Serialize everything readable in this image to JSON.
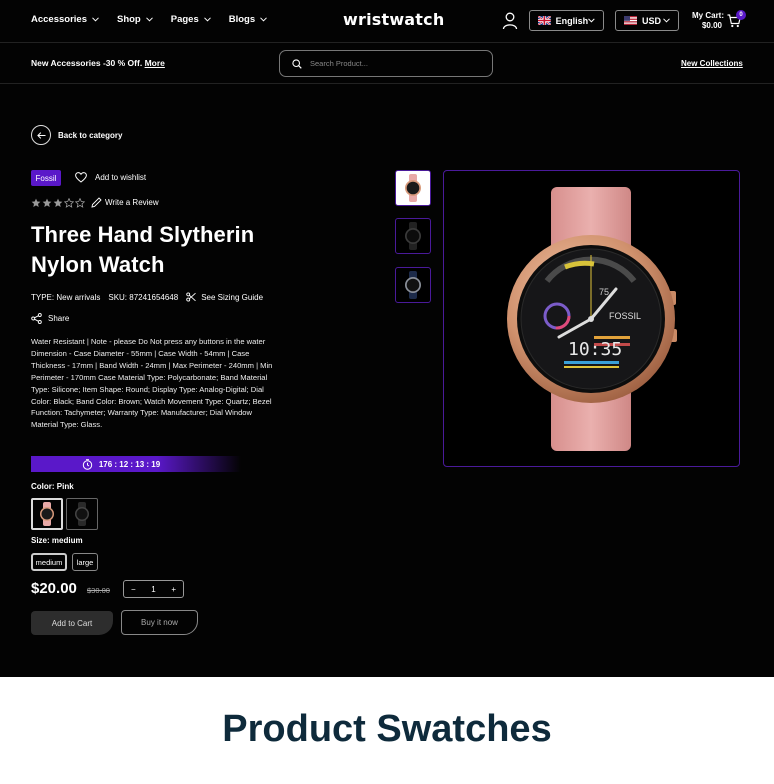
{
  "nav": {
    "menu": [
      "Accessories",
      "Shop",
      "Pages",
      "Blogs"
    ],
    "logo": "wristwatch",
    "language": "English",
    "currency": "USD",
    "cart_label": "My Cart:",
    "cart_total": "$0.00",
    "cart_count": "0"
  },
  "promo": {
    "text": "New Accessories -30 % Off.",
    "link": "More",
    "search_placeholder": "Search Product...",
    "new_collections": "New Collections"
  },
  "product": {
    "back_label": "Back to category",
    "brand": "Fossil",
    "wishlist_label": "Add to wishlist",
    "rating": 3,
    "rating_max": 5,
    "review_label": "Write a Review",
    "title_line1": "Three Hand Slytherin",
    "title_line2": "Nylon Watch",
    "type_label": "TYPE: New arrivals",
    "sku_label": "SKU: 87241654648",
    "sizing_label": "See Sizing Guide",
    "share_label": "Share",
    "description": "Water Resistant | Note - please Do Not press any buttons in the water Dimension - Case Diameter - 55mm | Case Width - 54mm | Case Thickness - 17mm | Band Width - 24mm | Max Perimeter - 240mm | Min Perimeter - 170mm Case Material Type: Polycarbonate; Band Material Type: Silicone; Item Shape: Round; Display Type: Analog-Digital; Dial Color: Black; Band Color: Brown; Watch Movement Type: Quartz; Bezel Function: Tachymeter; Warranty Type: Manufacturer; Dial Window Material Type: Glass.",
    "timer": "176 : 12 : 13 : 19",
    "color_label": "Color: Pink",
    "size_label": "Size: medium",
    "sizes": [
      "medium",
      "large"
    ],
    "price": "$20.00",
    "old_price": "$30.00",
    "qty_minus": "−",
    "qty": "1",
    "qty_plus": "+",
    "add_to_cart": "Add to Cart",
    "buy_now": "Buy it now"
  },
  "watch_face": {
    "brand_text": "FOSSIL",
    "time_text": "10:35",
    "small_number": "75"
  },
  "colors": {
    "accent": "#5a18c9",
    "strap": "#e8a9a7",
    "case": "#d89a7c",
    "caption": "#0e2a3b"
  },
  "caption": "Product Swatches"
}
